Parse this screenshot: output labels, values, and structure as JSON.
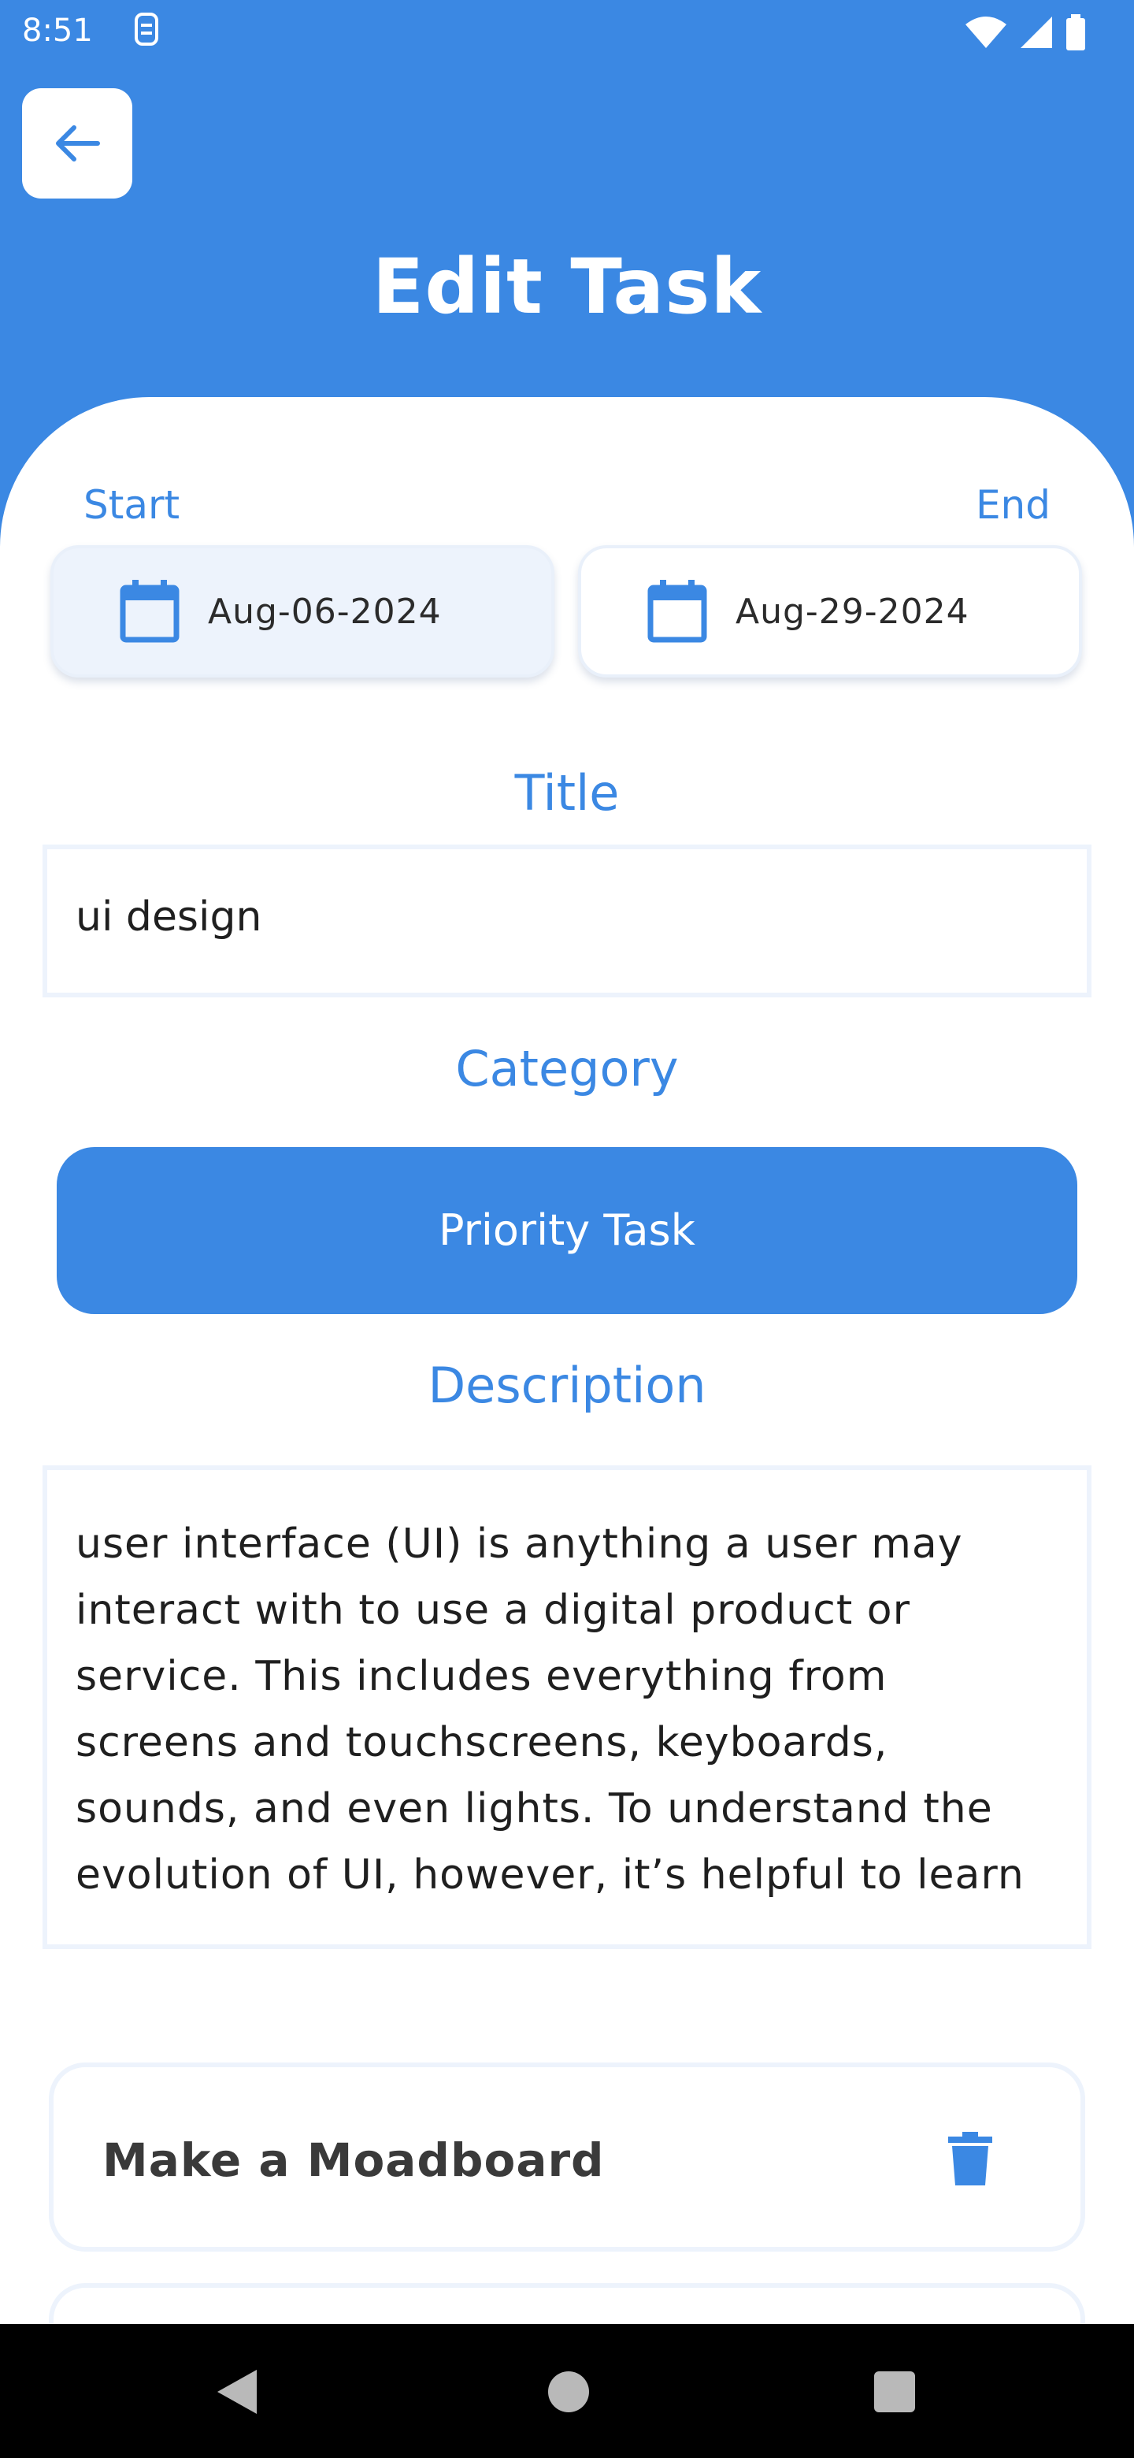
{
  "status_bar": {
    "time": "8:51"
  },
  "header": {
    "title": "Edit Task"
  },
  "dates": {
    "start_label": "Start",
    "end_label": "End",
    "start_value": "Aug-06-2024",
    "end_value": "Aug-29-2024"
  },
  "form": {
    "title_label": "Title",
    "title_value": "ui design",
    "category_label": "Category",
    "category_value": "Priority Task",
    "description_label": "Description",
    "description_value": "user interface (UI) is anything a user may interact with to use a digital product or service. This includes everything from screens and touchscreens, keyboards, sounds, and even lights. To understand the evolution of UI, however, it’s helpful to learn"
  },
  "subtasks": [
    {
      "label": "Make a Moadboard"
    }
  ],
  "colors": {
    "accent": "#3b88e3",
    "field_border": "#edf3fc"
  },
  "icons": [
    "back-arrow-icon",
    "calendar-icon",
    "trash-icon"
  ]
}
